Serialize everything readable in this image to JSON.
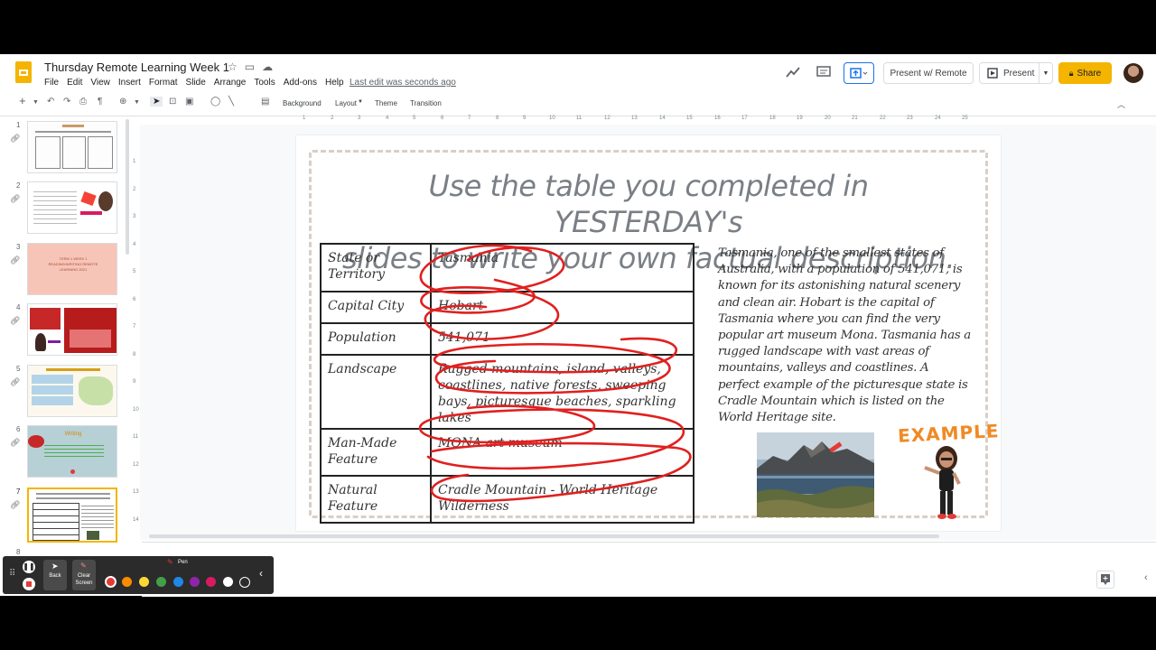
{
  "header": {
    "doc_title": "Thursday Remote Learning Week 1",
    "menu": [
      "File",
      "Edit",
      "View",
      "Insert",
      "Format",
      "Slide",
      "Arrange",
      "Tools",
      "Add-ons",
      "Help"
    ],
    "last_edit": "Last edit was seconds ago",
    "present_remote_label": "Present w/ Remote",
    "present_label": "Present",
    "share_label": "Share"
  },
  "toolbar": {
    "background_label": "Background",
    "layout_label": "Layout",
    "theme_label": "Theme",
    "transition_label": "Transition"
  },
  "ruler": {
    "marks": [
      "1",
      "2",
      "3",
      "4",
      "5",
      "6",
      "7",
      "8",
      "9",
      "10",
      "11",
      "12",
      "13",
      "14",
      "15",
      "16",
      "17",
      "18",
      "19",
      "20",
      "21",
      "22",
      "23",
      "24",
      "25"
    ],
    "vmarks": [
      "1",
      "2",
      "3",
      "4",
      "5",
      "6",
      "7",
      "8",
      "9",
      "10",
      "11",
      "12",
      "13",
      "14"
    ]
  },
  "filmstrip": {
    "numbers": [
      "1",
      "2",
      "3",
      "4",
      "5",
      "6",
      "7",
      "8"
    ],
    "slide3_text": "TERM 1 WEEK 1 READING/WRITING REMOTE LEARNING 2021",
    "slide6_title": "Writing"
  },
  "slide": {
    "title_line1": "Use the table you completed in YESTERDAY's",
    "title_line2": "slides to write your own factual description.",
    "table": [
      {
        "key": "State or Territory",
        "value": "Tasmania"
      },
      {
        "key": "Capital City",
        "value": "Hobart"
      },
      {
        "key": "Population",
        "value": "541,071"
      },
      {
        "key": "Landscape",
        "value": "Rugged mountains, island, valleys, coastlines, native forests, sweeping bays, picturesque beaches, sparkling lakes"
      },
      {
        "key": "Man-Made Feature",
        "value": "MONA art museum"
      },
      {
        "key": "Natural Feature",
        "value": "Cradle Mountain - World Heritage Wilderness"
      }
    ],
    "description": "Tasmania, one of the smallest states of Australia, with a population of 541,071, is known for its astonishing natural scenery and clean air. Hobart is the capital of Tasmania where you can find the very popular art museum Mona. Tasmania has a rugged landscape with vast areas of mountains, valleys and coastlines. A perfect example of the picturesque state is Cradle Mountain which is listed on the World Heritage site.",
    "example_label": "EXAMPLE"
  },
  "pen_toolbar": {
    "pen_label": "Pen",
    "back_label": "Back",
    "clear_label": "Clear Screen",
    "colors": [
      "#e53935",
      "#fb8c00",
      "#fdd835",
      "#43a047",
      "#1e88e5",
      "#8e24aa",
      "#d81b60",
      "#ffffff",
      "#2b2b2b"
    ]
  },
  "ink_color": "#e0201f",
  "accent_color": "#f4b400"
}
